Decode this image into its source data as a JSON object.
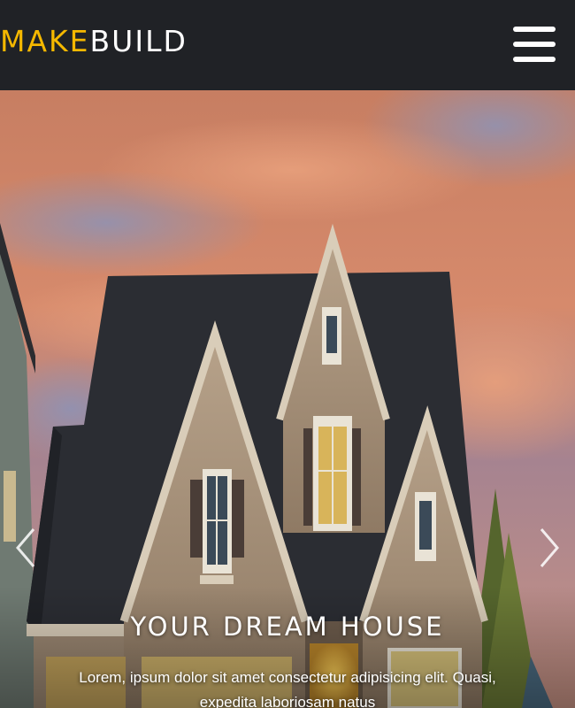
{
  "brand": {
    "part_a": "MAKE",
    "part_b": "BUILD",
    "color_a": "#f5b800",
    "color_b": "#ffffff"
  },
  "navbar": {
    "menu_icon": "hamburger-menu-icon",
    "background": "#202226"
  },
  "hero": {
    "image": "house-at-sunset",
    "title": "YOUR DREAM HOUSE",
    "text": "Lorem, ipsum dolor sit amet consectetur adipisicing elit. Quasi, expedita laboriosam natus",
    "prev_icon": "chevron-left-icon",
    "next_icon": "chevron-right-icon"
  }
}
